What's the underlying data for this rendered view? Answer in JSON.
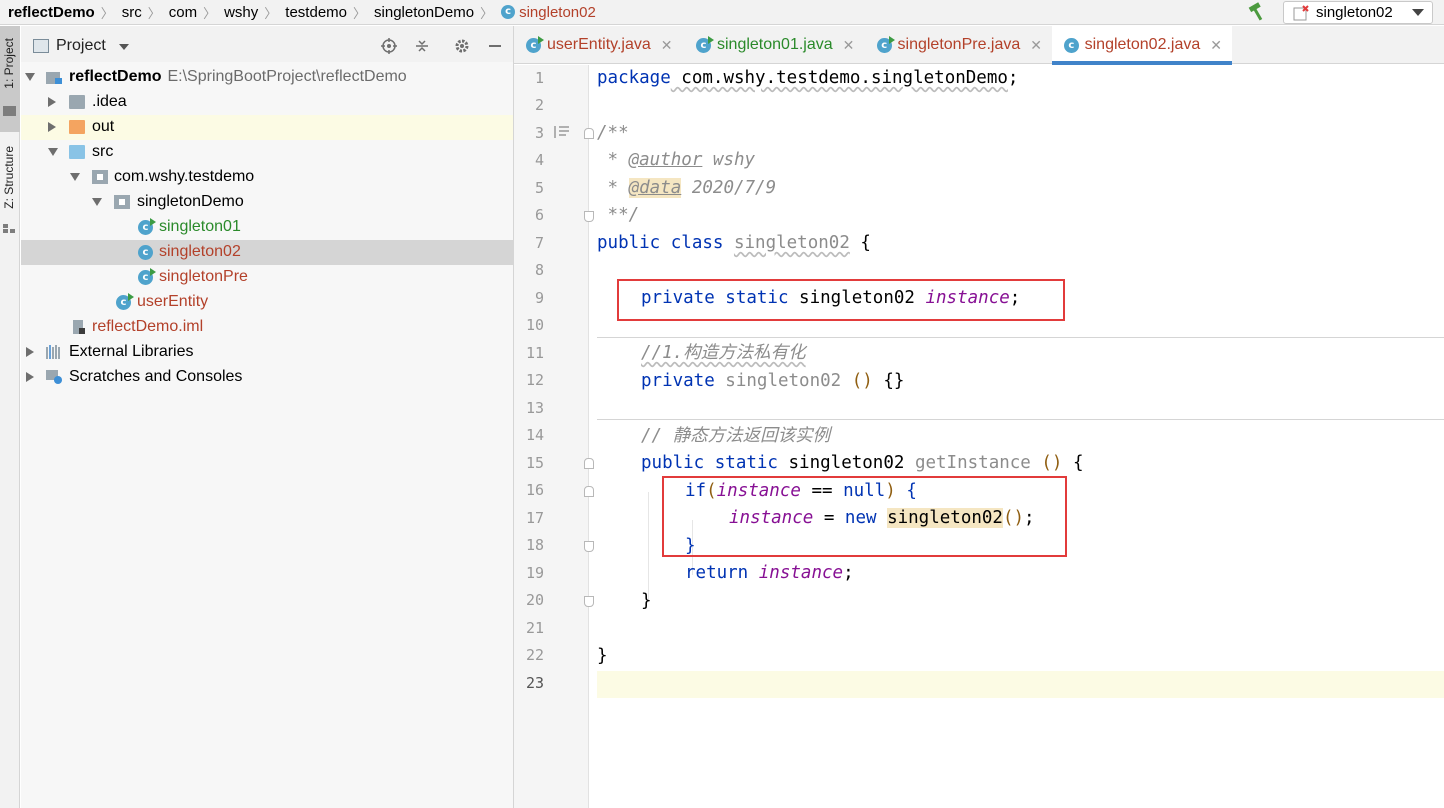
{
  "navbar": {
    "breadcrumbs": [
      "reflectDemo",
      "src",
      "com",
      "wshy",
      "testdemo",
      "singletonDemo",
      "singleton02"
    ],
    "run_config": "singleton02"
  },
  "stripe": {
    "project_tab": "1: Project",
    "structure_tab": "Z: Structure"
  },
  "project_panel": {
    "title": "Project",
    "tree": [
      {
        "label": "reflectDemo",
        "path": "E:\\SpringBootProject\\reflectDemo",
        "kind": "module",
        "expanded": true
      },
      {
        "label": ".idea",
        "kind": "folder-gray",
        "expanded": false
      },
      {
        "label": "out",
        "kind": "folder-orange",
        "expanded": false
      },
      {
        "label": "src",
        "kind": "folder-blue",
        "expanded": true
      },
      {
        "label": "com.wshy.testdemo",
        "kind": "package",
        "expanded": true
      },
      {
        "label": "singletonDemo",
        "kind": "package",
        "expanded": true
      },
      {
        "label": "singleton01",
        "kind": "class-run",
        "color": "green"
      },
      {
        "label": "singleton02",
        "kind": "class",
        "color": "red",
        "selected": true
      },
      {
        "label": "singletonPre",
        "kind": "class-run",
        "color": "red"
      },
      {
        "label": "userEntity",
        "kind": "class-run",
        "color": "red"
      },
      {
        "label": "reflectDemo.iml",
        "kind": "iml",
        "color": "red"
      },
      {
        "label": "External Libraries",
        "kind": "libraries",
        "expanded": false
      },
      {
        "label": "Scratches and Consoles",
        "kind": "scratches",
        "expanded": false
      }
    ]
  },
  "editor": {
    "tabs": [
      {
        "label": "userEntity.java",
        "color": "red",
        "active": false
      },
      {
        "label": "singleton01.java",
        "color": "green",
        "active": false
      },
      {
        "label": "singletonPre.java",
        "color": "red",
        "active": false
      },
      {
        "label": "singleton02.java",
        "color": "red",
        "active": true
      }
    ],
    "line_numbers": [
      "1",
      "2",
      "3",
      "4",
      "5",
      "6",
      "7",
      "8",
      "9",
      "10",
      "11",
      "12",
      "13",
      "14",
      "15",
      "16",
      "17",
      "18",
      "19",
      "20",
      "21",
      "22",
      "23"
    ],
    "code": {
      "l1_kw": "package",
      "l1_rest": " com.wshy.testdemo.singletonDemo",
      "l1_semi": ";",
      "l3": "/**",
      "l4_star": " * ",
      "l4_tag": "@author",
      "l4_val": " wshy",
      "l5_star": " * ",
      "l5_tag": "@data",
      "l5_val": " 2020/7/9",
      "l6": " **/",
      "l7_kw": "public class ",
      "l7_name": "singleton02",
      "l7_rest": " {",
      "l9_kw": "private static ",
      "l9_type": "singleton02 ",
      "l9_field": "instance",
      "l9_semi": ";",
      "l11": "//1.构造方法私有化",
      "l12_kw": "private ",
      "l12_name": "singleton02",
      "l12_paren": " ()",
      "l12_body": " {}",
      "l14": "// 静态方法返回该实例",
      "l15_kw": "public static ",
      "l15_type": "singleton02 ",
      "l15_name": "getInstance",
      "l15_paren": " ()",
      "l15_rest": " {",
      "l16_kw": "if",
      "l16_open": "(",
      "l16_field": "instance",
      "l16_op": " == ",
      "l16_null": "null",
      "l16_close": ")",
      "l16_rest": " {",
      "l17_field": "instance",
      "l17_op": " = ",
      "l17_new": "new ",
      "l17_ctor": "singleton02",
      "l17_paren": "()",
      "l17_semi": ";",
      "l18": "}",
      "l19_kw": "return ",
      "l19_field": "instance",
      "l19_semi": ";",
      "l20": "}",
      "l22": "}"
    }
  },
  "colors": {
    "keyword": "#0033b3",
    "field": "#871094",
    "comment": "#8c8c8c",
    "annotation_box": "#e23b3b",
    "selection": "#d5d5d5",
    "current_line": "#fcfbe4"
  }
}
